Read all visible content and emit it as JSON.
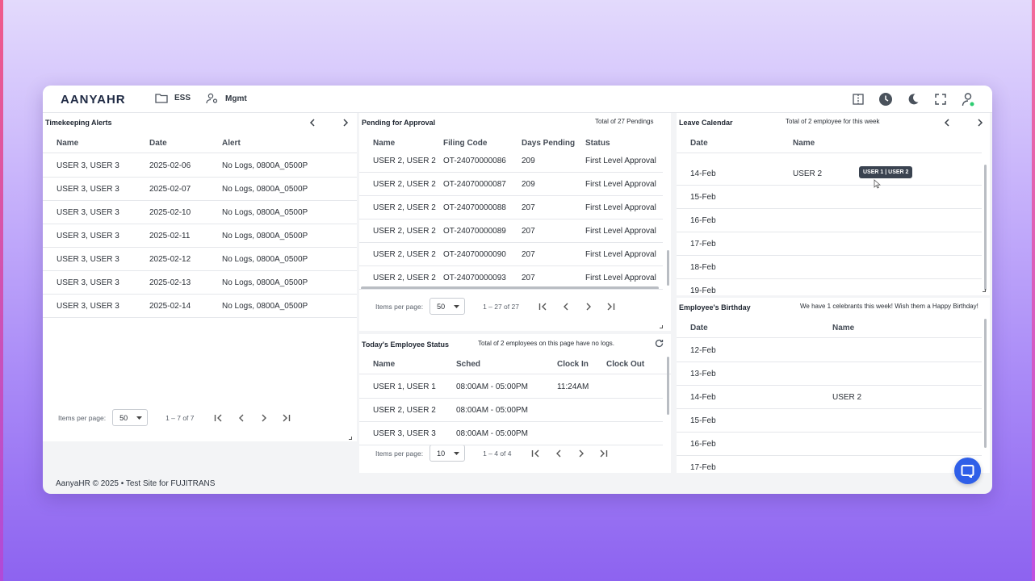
{
  "app": {
    "logo": "AANYAHR"
  },
  "nav": {
    "ess": "ESS",
    "mgmt": "Mgmt"
  },
  "top_icons": [
    "split-view-icon",
    "clock-icon",
    "moon-icon",
    "fullscreen-icon",
    "user-icon"
  ],
  "timekeeping": {
    "title": "Timekeeping Alerts",
    "columns": [
      "Name",
      "Date",
      "Alert"
    ],
    "rows": [
      [
        "USER 3, USER 3",
        "2025-02-06",
        "No Logs, 0800A_0500P"
      ],
      [
        "USER 3, USER 3",
        "2025-02-07",
        "No Logs, 0800A_0500P"
      ],
      [
        "USER 3, USER 3",
        "2025-02-10",
        "No Logs, 0800A_0500P"
      ],
      [
        "USER 3, USER 3",
        "2025-02-11",
        "No Logs, 0800A_0500P"
      ],
      [
        "USER 3, USER 3",
        "2025-02-12",
        "No Logs, 0800A_0500P"
      ],
      [
        "USER 3, USER 3",
        "2025-02-13",
        "No Logs, 0800A_0500P"
      ],
      [
        "USER 3, USER 3",
        "2025-02-14",
        "No Logs, 0800A_0500P"
      ]
    ],
    "pager": {
      "label": "Items per page:",
      "size": "50",
      "range": "1 – 7 of 7"
    }
  },
  "pending": {
    "title": "Pending for Approval",
    "note": "Total of 27 Pendings",
    "columns": [
      "Name",
      "Filing Code",
      "Days Pending",
      "Status"
    ],
    "rows": [
      [
        "USER 2, USER 2",
        "OT-24070000086",
        "209",
        "First Level Approval"
      ],
      [
        "USER 2, USER 2",
        "OT-24070000087",
        "209",
        "First Level Approval"
      ],
      [
        "USER 2, USER 2",
        "OT-24070000088",
        "207",
        "First Level Approval"
      ],
      [
        "USER 2, USER 2",
        "OT-24070000089",
        "207",
        "First Level Approval"
      ],
      [
        "USER 2, USER 2",
        "OT-24070000090",
        "207",
        "First Level Approval"
      ],
      [
        "USER 2, USER 2",
        "OT-24070000093",
        "207",
        "First Level Approval"
      ]
    ],
    "pager": {
      "label": "Items per page:",
      "size": "50",
      "range": "1 – 27 of 27"
    }
  },
  "status": {
    "title": "Today's Employee Status",
    "note": "Total of 2 employees on this page have no logs.",
    "columns": [
      "Name",
      "Sched",
      "Clock In",
      "Clock Out"
    ],
    "rows": [
      [
        "USER 1, USER 1",
        "08:00AM - 05:00PM",
        "11:24AM",
        ""
      ],
      [
        "USER 2, USER 2",
        "08:00AM - 05:00PM",
        "",
        ""
      ],
      [
        "USER 3, USER 3",
        "08:00AM - 05:00PM",
        "",
        ""
      ]
    ],
    "pager": {
      "label": "Items per page:",
      "size": "10",
      "range": "1 – 4 of 4"
    }
  },
  "leave": {
    "title": "Leave Calendar",
    "note": "Total of 2 employee for this week",
    "columns": [
      "Date",
      "Name"
    ],
    "rows": [
      [
        "14-Feb",
        "USER 2"
      ],
      [
        "15-Feb",
        ""
      ],
      [
        "16-Feb",
        ""
      ],
      [
        "17-Feb",
        ""
      ],
      [
        "18-Feb",
        ""
      ],
      [
        "19-Feb",
        ""
      ]
    ],
    "tooltip": "USER 1 | USER 2"
  },
  "birthday": {
    "title": "Employee's Birthday",
    "note": "We have 1 celebrants this week! Wish them a Happy Birthday!",
    "columns": [
      "Date",
      "Name"
    ],
    "rows": [
      [
        "12-Feb",
        ""
      ],
      [
        "13-Feb",
        ""
      ],
      [
        "14-Feb",
        "USER 2"
      ],
      [
        "15-Feb",
        ""
      ],
      [
        "16-Feb",
        ""
      ],
      [
        "17-Feb",
        ""
      ]
    ]
  },
  "footer": "AanyaHR © 2025 • Test Site for FUJITRANS"
}
